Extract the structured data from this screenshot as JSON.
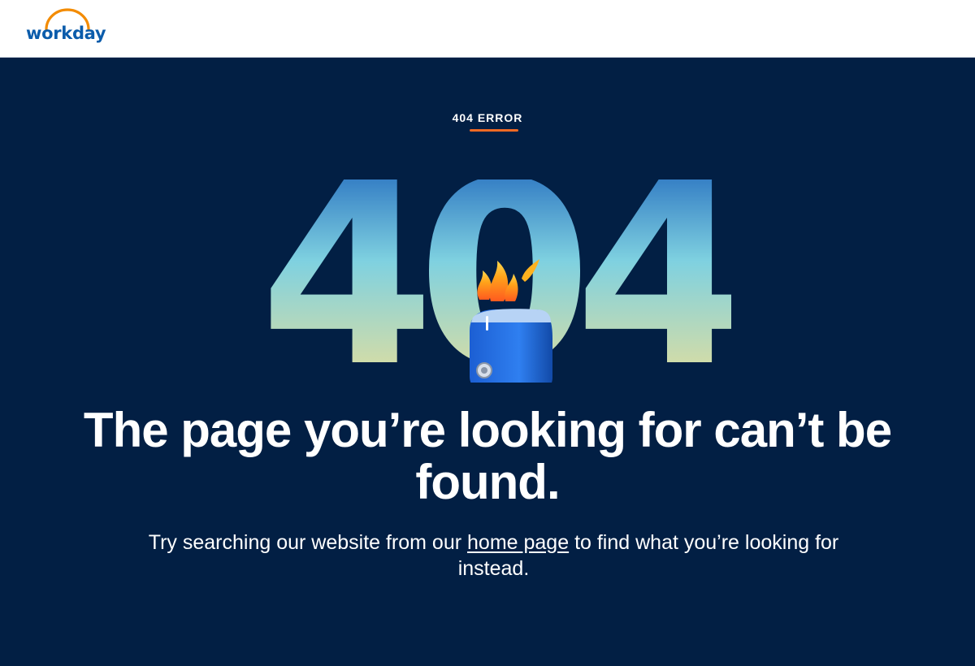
{
  "brand": {
    "logo_text": "workday",
    "logo_color": "#0b5cab",
    "arc_color": "#f38b00"
  },
  "colors": {
    "background": "#021f44",
    "accent": "#f06a24",
    "text": "#ffffff"
  },
  "error": {
    "eyebrow": "404 ERROR",
    "big_number": "404",
    "illustration": "flaming-toaster-icon"
  },
  "headline": "The page you’re looking for can’t be found.",
  "subtext": {
    "before_link": "Try searching our website from our ",
    "link_text": "home page",
    "after_link": " to find what you’re looking for instead."
  }
}
